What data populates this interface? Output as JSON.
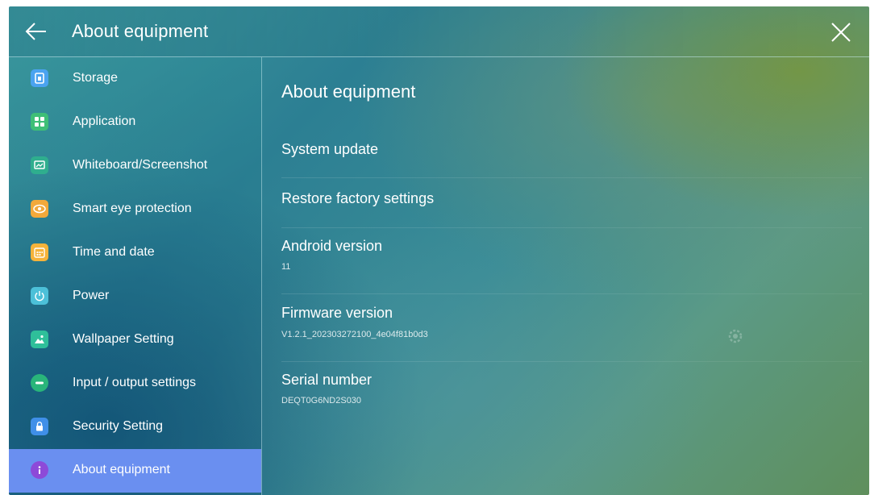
{
  "header": {
    "title": "About equipment"
  },
  "sidebar": {
    "items": [
      {
        "label": "Storage",
        "icon": "storage-icon",
        "color": "#4aa3f0"
      },
      {
        "label": "Application",
        "icon": "apps-grid-icon",
        "color": "#3fbf77"
      },
      {
        "label": "Whiteboard/Screenshot",
        "icon": "screenshot-icon",
        "color": "#2fae8e"
      },
      {
        "label": "Smart eye protection",
        "icon": "eye-icon",
        "color": "#f2a93b"
      },
      {
        "label": "Time and date",
        "icon": "calendar-icon",
        "color": "#f5b33a"
      },
      {
        "label": "Power",
        "icon": "power-icon",
        "color": "#4cc0d8"
      },
      {
        "label": "Wallpaper Setting",
        "icon": "wallpaper-icon",
        "color": "#2fbf9a"
      },
      {
        "label": "Input / output settings",
        "icon": "input-output-icon",
        "color": "#29b57a"
      },
      {
        "label": "Security Setting",
        "icon": "lock-icon",
        "color": "#3f8fe8"
      },
      {
        "label": "About equipment",
        "icon": "info-icon",
        "color": "#8d4ad8",
        "active": true
      }
    ]
  },
  "main": {
    "heading": "About equipment",
    "system_update": "System update",
    "restore_factory": "Restore factory settings",
    "android_version_label": "Android version",
    "android_version_value": "11",
    "firmware_version_label": "Firmware version",
    "firmware_version_value": "V1.2.1_202303272100_4e04f81b0d3",
    "serial_number_label": "Serial number",
    "serial_number_value": "DEQT0G6ND2S030"
  }
}
